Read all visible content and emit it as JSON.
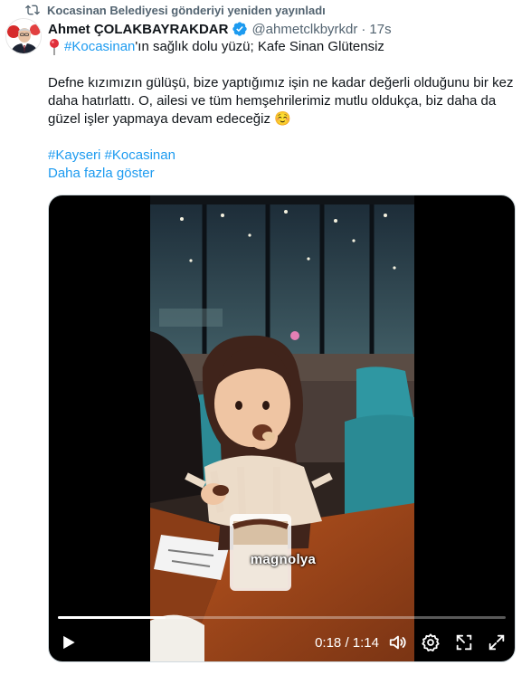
{
  "repost": {
    "text": "Kocasinan Belediyesi gönderiyi yeniden yayınladı",
    "icon": "repost-icon"
  },
  "author": {
    "display_name": "Ahmet ÇOLAKBAYRAKDAR",
    "handle": "@ahmetclkbyrkdr",
    "separator": "·",
    "time": "17s",
    "verified": true
  },
  "tweet": {
    "line1_hashtag": "#Kocasinan",
    "line1_rest": "'ın sağlık dolu yüzü; Kafe Sinan Glütensiz",
    "paragraph": "Defne kızımızın gülüşü, bize yaptığımız işin ne kadar değerli olduğunu bir kez daha hatırlattı. O, ailesi ve tüm hemşehrilerimiz mutlu oldukça, biz daha da güzel işler yapmaya devam edeceğiz",
    "emoji": "☺️",
    "hashtags": [
      "#Kayseri",
      "#Kocasinan"
    ],
    "show_more": "Daha fazla göster"
  },
  "video": {
    "caption": "magnolya",
    "current_time": "0:18",
    "duration": "1:14",
    "time_separator": " / ",
    "progress_fraction": 0.24
  },
  "colors": {
    "link": "#1d9bf0",
    "muted": "#536471",
    "text": "#0f1419",
    "verified": "#1d9bf0"
  }
}
